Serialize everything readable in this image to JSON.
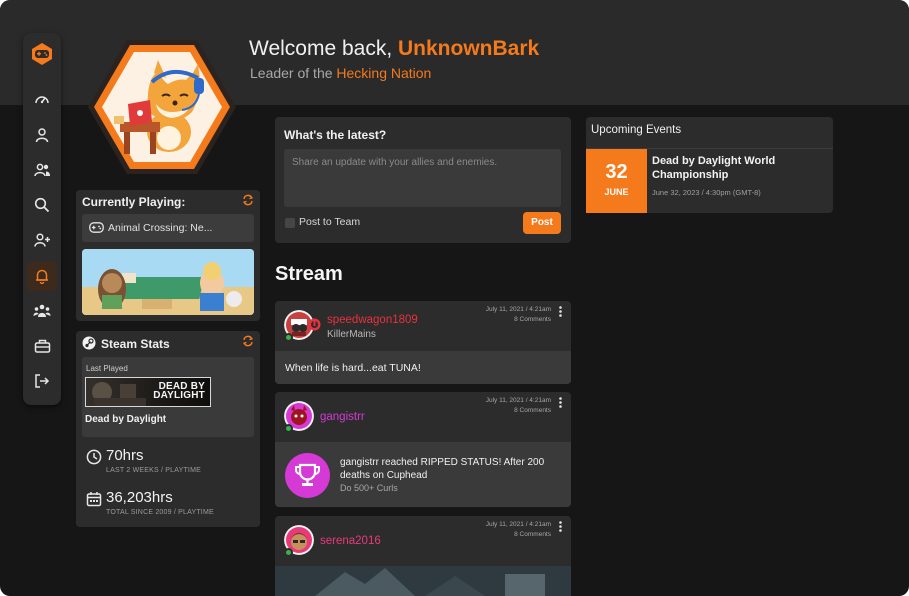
{
  "colors": {
    "accent": "#f47a1c",
    "bg": "#161616",
    "card": "#2c2c2c",
    "online": "#38b24a"
  },
  "header": {
    "welcome_prefix": "Welcome back, ",
    "username": "UnknownBark",
    "subtitle_prefix": "Leader of the ",
    "nation": "Hecking Nation"
  },
  "sidebar": {
    "items": [
      {
        "icon": "dashboard-icon"
      },
      {
        "icon": "profile-icon"
      },
      {
        "icon": "friends-icon"
      },
      {
        "icon": "search-icon"
      },
      {
        "icon": "add-friend-icon"
      },
      {
        "icon": "notifications-icon",
        "active": true
      },
      {
        "icon": "groups-icon"
      },
      {
        "icon": "store-icon"
      },
      {
        "icon": "logout-icon"
      }
    ]
  },
  "currently_playing": {
    "title": "Currently Playing:",
    "game": "Animal Crossing: Ne..."
  },
  "steam_stats": {
    "title": "Steam Stats",
    "last_played_label": "Last Played",
    "banner_line1": "DEAD BY",
    "banner_line2": "DAYLIGHT",
    "game_name": "Dead by Daylight",
    "stats": [
      {
        "value": "70hrs",
        "label": "LAST 2 WEEKS / PLAYTIME"
      },
      {
        "value": "36,203hrs",
        "label": "TOTAL SINCE 2009 / PLAYTIME"
      }
    ]
  },
  "whats_latest": {
    "title": "What's the latest?",
    "placeholder": "Share an update with your allies and enemies.",
    "checkbox_label": "Post to Team",
    "post_button": "Post"
  },
  "stream": {
    "title": "Stream",
    "posts": [
      {
        "user": "speedwagon1809",
        "user_color": "#e8323c",
        "team": "KillerMains",
        "date": "July 11, 2021 / 4:21am",
        "comments": "8 Comments",
        "text": "When life is hard...eat TUNA!"
      },
      {
        "user": "gangistrr",
        "user_color": "#d53ad6",
        "date": "July 11, 2021 / 4:21am",
        "comments": "8 Comments",
        "achievement": "gangistrr reached RIPPED STATUS! After 200 deaths on Cuphead",
        "achievement_sub": "Do 500+ Curls"
      },
      {
        "user": "serena2016",
        "user_color": "#e83a7a",
        "date": "July 11, 2021 / 4:21am",
        "comments": "8 Comments"
      }
    ]
  },
  "events": {
    "title": "Upcoming Events",
    "items": [
      {
        "day": "32",
        "month": "JUNE",
        "name": "Dead by Daylight World Championship",
        "time": "June 32, 2023 / 4:30pm (GMT-8)"
      }
    ]
  }
}
